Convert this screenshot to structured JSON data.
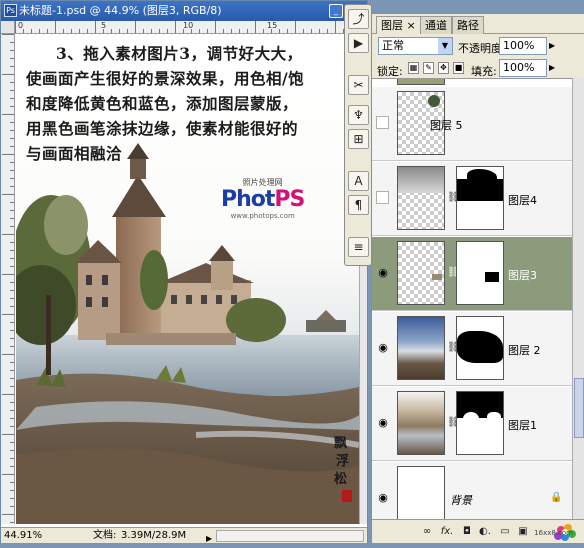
{
  "document": {
    "title": "未标题-1.psd @ 44.9% (图层3, RGB/8)",
    "ruler_numbers": [
      "0",
      "5",
      "10",
      "15"
    ],
    "instructions": [
      "3、拖入素材图片3，调节好大大，",
      "使画面产生很好的景深效果，用色相/饱",
      "和度降低黄色和蓝色，添加图层蒙版，",
      "用黑色画笔涂抹边缘，使素材能很好的",
      "与画面相融洽"
    ],
    "watermark": {
      "top": "照片处理网",
      "logo_a": "Phot",
      "logo_b": "PS",
      "url": "www.photops.com"
    },
    "zoom": "44.91%",
    "docsize_label": "文档:",
    "docsize": "3.39M/28.9M",
    "colors": {
      "titlebar": "#2a5aa8",
      "logo_blue": "#1a3ea8",
      "logo_pink": "#d0127a"
    }
  },
  "toolstrip": {
    "icons": [
      "history-brush-icon",
      "actions-play-icon",
      "tools-icon",
      "brush-presets-icon",
      "clone-source-icon",
      "character-icon",
      "paragraph-icon",
      "layer-comps-icon"
    ]
  },
  "panel": {
    "tabs": [
      "图层 ×",
      "通道",
      "路径"
    ],
    "blend_mode": "正常",
    "opacity_label": "不透明度:",
    "opacity": "100%",
    "lock_label": "锁定:",
    "fill_label": "填充:",
    "fill": "100%",
    "layers": [
      {
        "name": "图层 5",
        "visible": false,
        "has_mask": false,
        "selected": false
      },
      {
        "name": "图层4",
        "visible": false,
        "has_mask": true,
        "selected": false
      },
      {
        "name": "图层3",
        "visible": true,
        "has_mask": true,
        "selected": true
      },
      {
        "name": "图层 2",
        "visible": true,
        "has_mask": true,
        "selected": false
      },
      {
        "name": "图层1",
        "visible": true,
        "has_mask": true,
        "selected": false
      },
      {
        "name": "背景",
        "visible": true,
        "has_mask": false,
        "selected": false,
        "locked": true
      }
    ],
    "bottom_icons": [
      "link-layers-icon",
      "layer-style-icon",
      "add-mask-icon",
      "adjustment-layer-icon",
      "new-group-icon",
      "new-layer-icon",
      "delete-layer-icon"
    ],
    "bottom_labels": [
      "∞",
      "fx.",
      "◘",
      "◐.",
      "▭",
      "▣",
      "🗑"
    ],
    "brand": "16xx8.com"
  }
}
